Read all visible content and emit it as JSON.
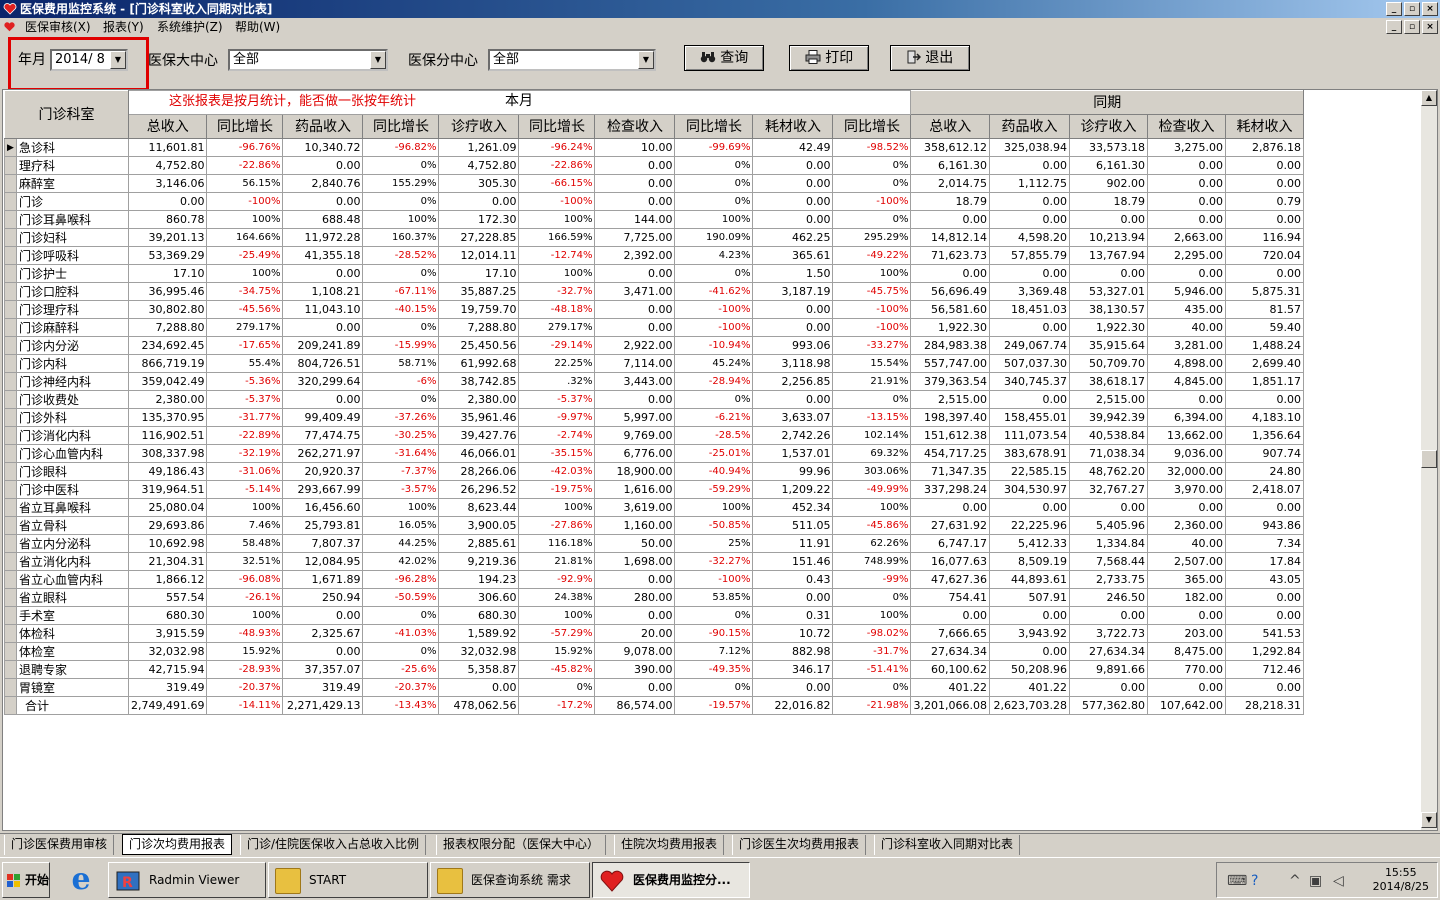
{
  "window": {
    "title": "医保费用监控系统 - [门诊科室收入同期对比表]",
    "min_glyph": "_",
    "max_glyph": "▫",
    "close_glyph": "×"
  },
  "menu": {
    "items": [
      "医保审核(X)",
      "报表(Y)",
      "系统维护(Z)",
      "帮助(W)"
    ]
  },
  "toolbar": {
    "month_label": "年月",
    "month_value": "2014/  8",
    "center_label": "医保大中心",
    "center_value": "全部",
    "subcenter_label": "医保分中心",
    "subcenter_value": "全部",
    "query_label": "查询",
    "print_label": "打印",
    "exit_label": "退出",
    "dropdown_arrow": "▼"
  },
  "colors": {
    "negative": "#e00000",
    "annotation_box": "#e00000",
    "titlebar": "#0a246a"
  },
  "report": {
    "dept_header": "门诊科室",
    "note": "这张报表是按月统计，能否做一张按年统计",
    "group_current": "本月",
    "group_prior": "同期",
    "columns": [
      "总收入",
      "同比增长",
      "药品收入",
      "同比增长",
      "诊疗收入",
      "同比增长",
      "检查收入",
      "同比增长",
      "耗材收入",
      "同比增长",
      "总收入",
      "药品收入",
      "诊疗收入",
      "检查收入",
      "耗材收入"
    ],
    "row_pointer": "▶",
    "rows": [
      [
        "急诊科",
        "11,601.81",
        "-96.76%",
        "10,340.72",
        "-96.82%",
        "1,261.09",
        "-96.24%",
        "10.00",
        "-99.69%",
        "42.49",
        "-98.52%",
        "358,612.12",
        "325,038.94",
        "33,573.18",
        "3,275.00",
        "2,876.18"
      ],
      [
        "理疗科",
        "4,752.80",
        "-22.86%",
        "0.00",
        "0%",
        "4,752.80",
        "-22.86%",
        "0.00",
        "0%",
        "0.00",
        "0%",
        "6,161.30",
        "0.00",
        "6,161.30",
        "0.00",
        "0.00"
      ],
      [
        "麻醉室",
        "3,146.06",
        "56.15%",
        "2,840.76",
        "155.29%",
        "305.30",
        "-66.15%",
        "0.00",
        "0%",
        "0.00",
        "0%",
        "2,014.75",
        "1,112.75",
        "902.00",
        "0.00",
        "0.00"
      ],
      [
        "门诊",
        "0.00",
        "-100%",
        "0.00",
        "0%",
        "0.00",
        "-100%",
        "0.00",
        "0%",
        "0.00",
        "-100%",
        "18.79",
        "0.00",
        "18.79",
        "0.00",
        "0.79"
      ],
      [
        "门诊耳鼻喉科",
        "860.78",
        "100%",
        "688.48",
        "100%",
        "172.30",
        "100%",
        "144.00",
        "100%",
        "0.00",
        "0%",
        "0.00",
        "0.00",
        "0.00",
        "0.00",
        "0.00"
      ],
      [
        "门诊妇科",
        "39,201.13",
        "164.66%",
        "11,972.28",
        "160.37%",
        "27,228.85",
        "166.59%",
        "7,725.00",
        "190.09%",
        "462.25",
        "295.29%",
        "14,812.14",
        "4,598.20",
        "10,213.94",
        "2,663.00",
        "116.94"
      ],
      [
        "门诊呼吸科",
        "53,369.29",
        "-25.49%",
        "41,355.18",
        "-28.52%",
        "12,014.11",
        "-12.74%",
        "2,392.00",
        "4.23%",
        "365.61",
        "-49.22%",
        "71,623.73",
        "57,855.79",
        "13,767.94",
        "2,295.00",
        "720.04"
      ],
      [
        "门诊护士",
        "17.10",
        "100%",
        "0.00",
        "0%",
        "17.10",
        "100%",
        "0.00",
        "0%",
        "1.50",
        "100%",
        "0.00",
        "0.00",
        "0.00",
        "0.00",
        "0.00"
      ],
      [
        "门诊口腔科",
        "36,995.46",
        "-34.75%",
        "1,108.21",
        "-67.11%",
        "35,887.25",
        "-32.7%",
        "3,471.00",
        "-41.62%",
        "3,187.19",
        "-45.75%",
        "56,696.49",
        "3,369.48",
        "53,327.01",
        "5,946.00",
        "5,875.31"
      ],
      [
        "门诊理疗科",
        "30,802.80",
        "-45.56%",
        "11,043.10",
        "-40.15%",
        "19,759.70",
        "-48.18%",
        "0.00",
        "-100%",
        "0.00",
        "-100%",
        "56,581.60",
        "18,451.03",
        "38,130.57",
        "435.00",
        "81.57"
      ],
      [
        "门诊麻醉科",
        "7,288.80",
        "279.17%",
        "0.00",
        "0%",
        "7,288.80",
        "279.17%",
        "0.00",
        "-100%",
        "0.00",
        "-100%",
        "1,922.30",
        "0.00",
        "1,922.30",
        "40.00",
        "59.40"
      ],
      [
        "门诊内分泌",
        "234,692.45",
        "-17.65%",
        "209,241.89",
        "-15.99%",
        "25,450.56",
        "-29.14%",
        "2,922.00",
        "-10.94%",
        "993.06",
        "-33.27%",
        "284,983.38",
        "249,067.74",
        "35,915.64",
        "3,281.00",
        "1,488.24"
      ],
      [
        "门诊内科",
        "866,719.19",
        "55.4%",
        "804,726.51",
        "58.71%",
        "61,992.68",
        "22.25%",
        "7,114.00",
        "45.24%",
        "3,118.98",
        "15.54%",
        "557,747.00",
        "507,037.30",
        "50,709.70",
        "4,898.00",
        "2,699.40"
      ],
      [
        "门诊神经内科",
        "359,042.49",
        "-5.36%",
        "320,299.64",
        "-6%",
        "38,742.85",
        ".32%",
        "3,443.00",
        "-28.94%",
        "2,256.85",
        "21.91%",
        "379,363.54",
        "340,745.37",
        "38,618.17",
        "4,845.00",
        "1,851.17"
      ],
      [
        "门诊收费处",
        "2,380.00",
        "-5.37%",
        "0.00",
        "0%",
        "2,380.00",
        "-5.37%",
        "0.00",
        "0%",
        "0.00",
        "0%",
        "2,515.00",
        "0.00",
        "2,515.00",
        "0.00",
        "0.00"
      ],
      [
        "门诊外科",
        "135,370.95",
        "-31.77%",
        "99,409.49",
        "-37.26%",
        "35,961.46",
        "-9.97%",
        "5,997.00",
        "-6.21%",
        "3,633.07",
        "-13.15%",
        "198,397.40",
        "158,455.01",
        "39,942.39",
        "6,394.00",
        "4,183.10"
      ],
      [
        "门诊消化内科",
        "116,902.51",
        "-22.89%",
        "77,474.75",
        "-30.25%",
        "39,427.76",
        "-2.74%",
        "9,769.00",
        "-28.5%",
        "2,742.26",
        "102.14%",
        "151,612.38",
        "111,073.54",
        "40,538.84",
        "13,662.00",
        "1,356.64"
      ],
      [
        "门诊心血管内科",
        "308,337.98",
        "-32.19%",
        "262,271.97",
        "-31.64%",
        "46,066.01",
        "-35.15%",
        "6,776.00",
        "-25.01%",
        "1,537.01",
        "69.32%",
        "454,717.25",
        "383,678.91",
        "71,038.34",
        "9,036.00",
        "907.74"
      ],
      [
        "门诊眼科",
        "49,186.43",
        "-31.06%",
        "20,920.37",
        "-7.37%",
        "28,266.06",
        "-42.03%",
        "18,900.00",
        "-40.94%",
        "99.96",
        "303.06%",
        "71,347.35",
        "22,585.15",
        "48,762.20",
        "32,000.00",
        "24.80"
      ],
      [
        "门诊中医科",
        "319,964.51",
        "-5.14%",
        "293,667.99",
        "-3.57%",
        "26,296.52",
        "-19.75%",
        "1,616.00",
        "-59.29%",
        "1,209.22",
        "-49.99%",
        "337,298.24",
        "304,530.97",
        "32,767.27",
        "3,970.00",
        "2,418.07"
      ],
      [
        "省立耳鼻喉科",
        "25,080.04",
        "100%",
        "16,456.60",
        "100%",
        "8,623.44",
        "100%",
        "3,619.00",
        "100%",
        "452.34",
        "100%",
        "0.00",
        "0.00",
        "0.00",
        "0.00",
        "0.00"
      ],
      [
        "省立骨科",
        "29,693.86",
        "7.46%",
        "25,793.81",
        "16.05%",
        "3,900.05",
        "-27.86%",
        "1,160.00",
        "-50.85%",
        "511.05",
        "-45.86%",
        "27,631.92",
        "22,225.96",
        "5,405.96",
        "2,360.00",
        "943.86"
      ],
      [
        "省立内分泌科",
        "10,692.98",
        "58.48%",
        "7,807.37",
        "44.25%",
        "2,885.61",
        "116.18%",
        "50.00",
        "25%",
        "11.91",
        "62.26%",
        "6,747.17",
        "5,412.33",
        "1,334.84",
        "40.00",
        "7.34"
      ],
      [
        "省立消化内科",
        "21,304.31",
        "32.51%",
        "12,084.95",
        "42.02%",
        "9,219.36",
        "21.81%",
        "1,698.00",
        "-32.27%",
        "151.46",
        "748.99%",
        "16,077.63",
        "8,509.19",
        "7,568.44",
        "2,507.00",
        "17.84"
      ],
      [
        "省立心血管内科",
        "1,866.12",
        "-96.08%",
        "1,671.89",
        "-96.28%",
        "194.23",
        "-92.9%",
        "0.00",
        "-100%",
        "0.43",
        "-99%",
        "47,627.36",
        "44,893.61",
        "2,733.75",
        "365.00",
        "43.05"
      ],
      [
        "省立眼科",
        "557.54",
        "-26.1%",
        "250.94",
        "-50.59%",
        "306.60",
        "24.38%",
        "280.00",
        "53.85%",
        "0.00",
        "0%",
        "754.41",
        "507.91",
        "246.50",
        "182.00",
        "0.00"
      ],
      [
        "手术室",
        "680.30",
        "100%",
        "0.00",
        "0%",
        "680.30",
        "100%",
        "0.00",
        "0%",
        "0.31",
        "100%",
        "0.00",
        "0.00",
        "0.00",
        "0.00",
        "0.00"
      ],
      [
        "体检科",
        "3,915.59",
        "-48.93%",
        "2,325.67",
        "-41.03%",
        "1,589.92",
        "-57.29%",
        "20.00",
        "-90.15%",
        "10.72",
        "-98.02%",
        "7,666.65",
        "3,943.92",
        "3,722.73",
        "203.00",
        "541.53"
      ],
      [
        "体检室",
        "32,032.98",
        "15.92%",
        "0.00",
        "0%",
        "32,032.98",
        "15.92%",
        "9,078.00",
        "7.12%",
        "882.98",
        "-31.7%",
        "27,634.34",
        "0.00",
        "27,634.34",
        "8,475.00",
        "1,292.84"
      ],
      [
        "退聘专家",
        "42,715.94",
        "-28.93%",
        "37,357.07",
        "-25.6%",
        "5,358.87",
        "-45.82%",
        "390.00",
        "-49.35%",
        "346.17",
        "-51.41%",
        "60,100.62",
        "50,208.96",
        "9,891.66",
        "770.00",
        "712.46"
      ],
      [
        "胃镜室",
        "319.49",
        "-20.37%",
        "319.49",
        "-20.37%",
        "0.00",
        "0%",
        "0.00",
        "0%",
        "0.00",
        "0%",
        "401.22",
        "401.22",
        "0.00",
        "0.00",
        "0.00"
      ],
      [
        "合计",
        "2,749,491.69",
        "-14.11%",
        "2,271,429.13",
        "-13.43%",
        "478,062.56",
        "-17.2%",
        "86,574.00",
        "-19.57%",
        "22,016.82",
        "-21.98%",
        "3,201,066.08",
        "2,623,703.28",
        "577,362.80",
        "107,642.00",
        "28,218.31"
      ]
    ]
  },
  "scrollbar": {
    "up": "▲",
    "down": "▼"
  },
  "tabs": [
    "门诊医保费用审核",
    "门诊次均费用报表",
    "门诊/住院医保收入占总收入比例",
    "报表权限分配（医保大中心）",
    "住院次均费用报表",
    "门诊医生次均费用报表",
    "门诊科室收入同期对比表"
  ],
  "taskbar": {
    "start_label": "开始",
    "ie_glyph": "e",
    "buttons": [
      "Radmin Viewer",
      "START",
      "医保查询系统 需求",
      "医保费用监控分..."
    ],
    "time": "15:55",
    "date": "2014/8/25"
  }
}
